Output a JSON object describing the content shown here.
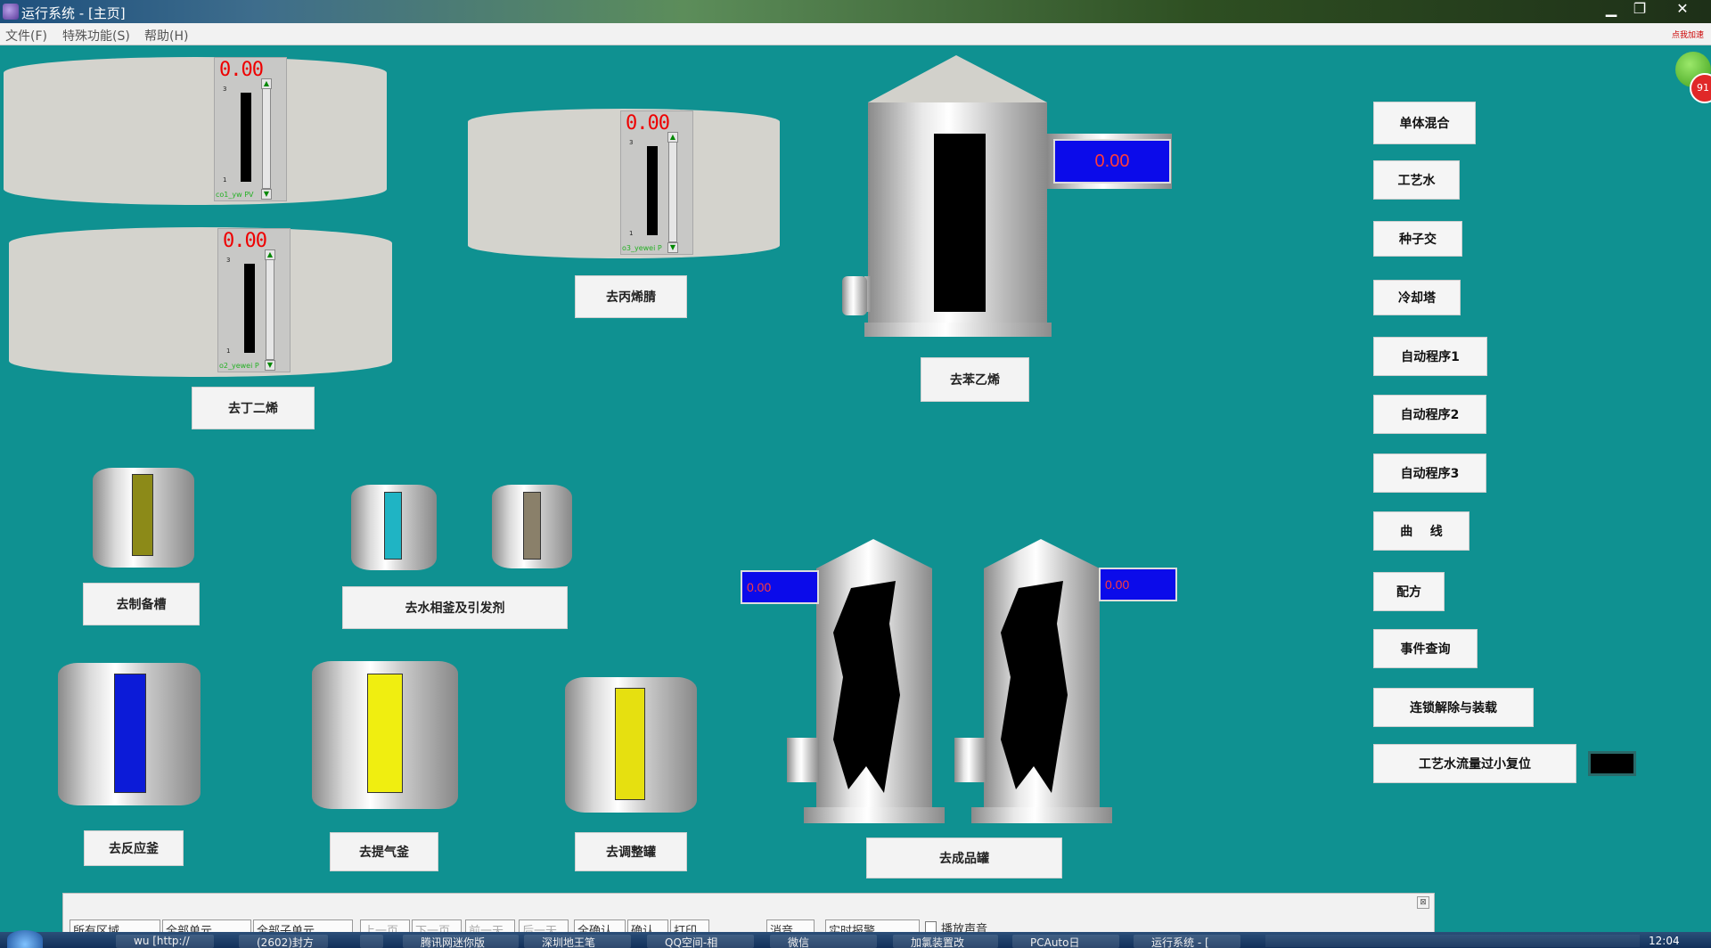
{
  "window": {
    "title": "运行系统 - [主页]",
    "min_label": "▁",
    "max_label": "❐",
    "close_label": "✕"
  },
  "menu": [
    "文件(F)",
    "特殊功能(S)",
    "帮助(H)"
  ],
  "addon_text": "点我加速",
  "badge_text": "91",
  "gauges": [
    {
      "value": "0.00",
      "top_tick": "3",
      "bottom_tick": "1",
      "tag": "co1_yw PV",
      "level": 0.75
    },
    {
      "value": "0.00",
      "top_tick": "3",
      "bottom_tick": "1",
      "tag": "o2_yewei P",
      "level": 0.75
    },
    {
      "value": "0.00",
      "top_tick": "3",
      "bottom_tick": "1",
      "tag": "o3_yewei P",
      "level": 0.78
    }
  ],
  "silo_display": "0.00",
  "reactor_displays": [
    "0.00",
    "0.00"
  ],
  "tank_labels": {
    "butadiene": "去丁二烯",
    "acrylonitrile": "去丙烯腈",
    "styrene": "去苯乙烯",
    "prep_tank": "去制备槽",
    "water_phase": "去水相釜及引发剂",
    "reactor": "去反应釜",
    "stripping": "去提气釜",
    "adjust": "去调整罐",
    "product": "去成品罐"
  },
  "tank_stripe_colors": {
    "prep": "#8c8a18",
    "water1": "#1fb4c4",
    "water2": "#8a806a",
    "reactor": "#0c1bd8",
    "stripping": "#f0ee10",
    "adjust": "#e6e010"
  },
  "side_buttons": [
    "单体混合",
    "工艺水",
    "种子交",
    "冷却塔",
    "自动程序1",
    "自动程序2",
    "自动程序3",
    "曲    线",
    "配方",
    "事件查询",
    "连锁解除与装载",
    "工艺水流量过小复位"
  ],
  "statusbar": {
    "items": [
      "所有区域",
      "全部单元",
      "全部子单元",
      "上一页",
      "下一页",
      "前一天",
      "后一天",
      "全确认",
      "确认",
      "打印",
      "消音",
      "实时报警",
      "播放声音"
    ]
  },
  "taskbar": {
    "items": [
      "wu [http://",
      "(2602)封方",
      "",
      "腾讯网迷你版",
      "深圳地王笔",
      "QQ空间-相",
      "微信",
      "加氯装置改",
      "PCAuto日",
      "运行系统 - ["
    ],
    "clock": "12:04"
  }
}
